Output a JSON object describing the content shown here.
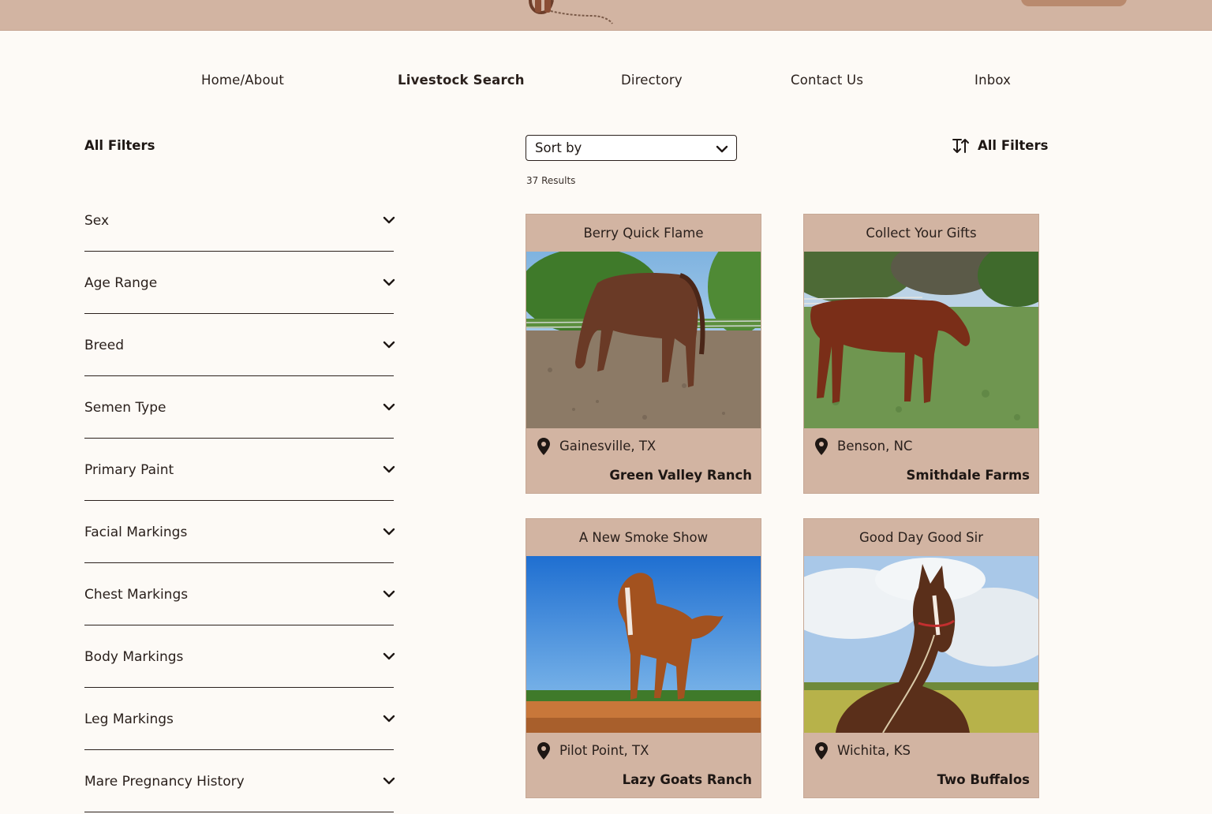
{
  "nav": {
    "items": [
      {
        "label": "Home/About",
        "active": false
      },
      {
        "label": "Livestock Search",
        "active": true
      },
      {
        "label": "Directory",
        "active": false
      },
      {
        "label": "Contact Us",
        "active": false
      },
      {
        "label": "Inbox",
        "active": false
      }
    ]
  },
  "sidebar": {
    "title": "All Filters",
    "filters": [
      "Sex",
      "Age Range",
      "Breed",
      "Semen Type",
      "Primary Paint",
      "Facial Markings",
      "Chest Markings",
      "Body Markings",
      "Leg Markings",
      "Mare Pregnancy History"
    ]
  },
  "toolbar": {
    "sort_label": "Sort by",
    "results": "37 Results",
    "all_filters_label": "All Filters"
  },
  "listings": [
    {
      "name": "Berry Quick Flame",
      "location": "Gainesville, TX",
      "ranch": "Green Valley Ranch",
      "photo": "horse-grazing-arena"
    },
    {
      "name": "Collect Your Gifts",
      "location": "Benson, NC",
      "ranch": "Smithdale Farms",
      "photo": "horse-grazing-pasture"
    },
    {
      "name": "A New Smoke Show",
      "location": "Pilot Point, TX",
      "ranch": "Lazy Goats Ranch",
      "photo": "horse-blue-sky"
    },
    {
      "name": "Good Day Good Sir",
      "location": "Wichita, KS",
      "ranch": "Two Buffalos",
      "photo": "horse-halter-clouds"
    }
  ],
  "colors": {
    "header": "#d2b4a2",
    "card": "#d2b4a2",
    "background": "#fdfaf6",
    "accent": "#b98a6e",
    "text": "#1e1714"
  }
}
